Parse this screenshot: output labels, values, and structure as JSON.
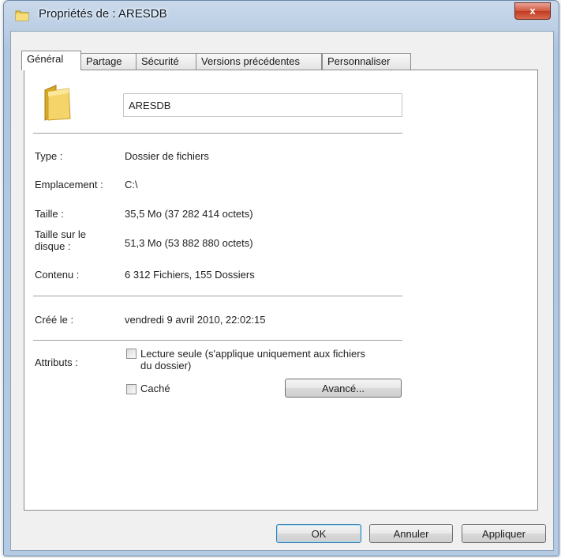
{
  "window": {
    "title": "Propriétés de : ARESDB",
    "close_glyph": "x",
    "icon": "folder-icon"
  },
  "tabs": [
    {
      "label": "Général",
      "active": true
    },
    {
      "label": "Partage",
      "active": false
    },
    {
      "label": "Sécurité",
      "active": false
    },
    {
      "label": "Versions précédentes",
      "active": false
    },
    {
      "label": "Personnaliser",
      "active": false
    }
  ],
  "general": {
    "folder_name": "ARESDB",
    "type": {
      "label": "Type :",
      "value": "Dossier de fichiers"
    },
    "location": {
      "label": "Emplacement :",
      "value": "C:\\"
    },
    "size": {
      "label": "Taille :",
      "value": "35,5 Mo (37 282 414 octets)"
    },
    "size_on_disk": {
      "label": "Taille sur le disque :",
      "value": "51,3 Mo (53 882 880 octets)"
    },
    "contents": {
      "label": "Contenu :",
      "value": "6 312 Fichiers, 155 Dossiers"
    },
    "created": {
      "label": "Créé le :",
      "value": "vendredi 9 avril 2010, 22:02:15"
    },
    "attributes": {
      "label": "Attributs :",
      "readonly_label": "Lecture seule (s'applique uniquement aux fichiers du dossier)",
      "readonly_checked": false,
      "hidden_label": "Caché",
      "hidden_checked": false,
      "advanced_button": "Avancé..."
    }
  },
  "buttons": {
    "ok": "OK",
    "cancel": "Annuler",
    "apply": "Appliquer"
  }
}
